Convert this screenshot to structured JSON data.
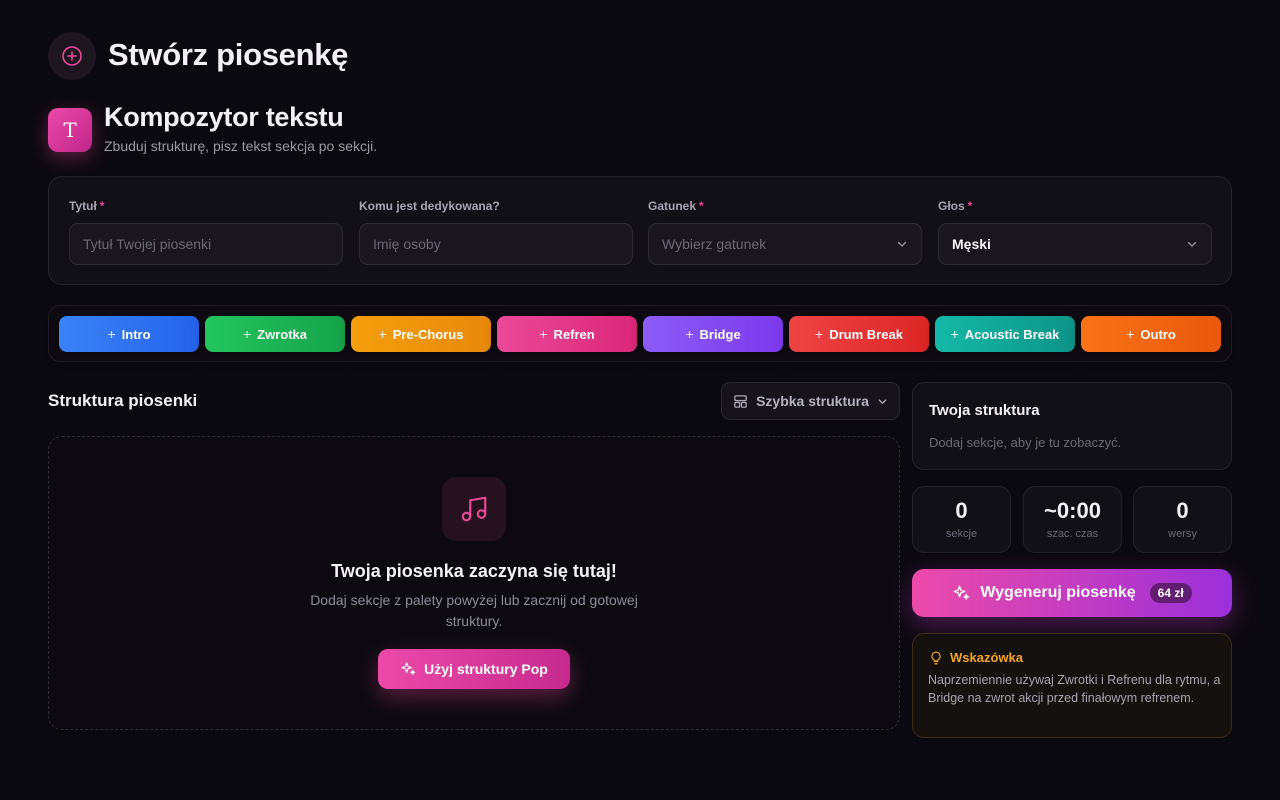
{
  "header": {
    "title": "Stwórz piosenkę",
    "icon": "plus-circle-icon"
  },
  "composer": {
    "icon_letter": "T",
    "title": "Kompozytor tekstu",
    "subtitle": "Zbuduj strukturę, pisz tekst sekcja po sekcji."
  },
  "form": {
    "title_field": {
      "label": "Tytuł",
      "required": "*",
      "placeholder": "Tytuł Twojej piosenki"
    },
    "dedication_field": {
      "label": "Komu jest dedykowana?",
      "placeholder": "Imię osoby"
    },
    "genre_field": {
      "label": "Gatunek",
      "required": "*",
      "placeholder": "Wybierz gatunek"
    },
    "voice_field": {
      "label": "Głos",
      "required": "*",
      "value": "Męski"
    }
  },
  "palette": {
    "items": [
      {
        "label": "Intro",
        "color_from": "#3b82f6",
        "color_to": "#2563eb"
      },
      {
        "label": "Zwrotka",
        "color_from": "#22c55e",
        "color_to": "#16a34a"
      },
      {
        "label": "Pre-Chorus",
        "color_from": "#f59e0b",
        "color_to": "#e8890b"
      },
      {
        "label": "Refren",
        "color_from": "#ec4899",
        "color_to": "#db2777"
      },
      {
        "label": "Bridge",
        "color_from": "#8b5cf6",
        "color_to": "#7c3aed"
      },
      {
        "label": "Drum Break",
        "color_from": "#ef4444",
        "color_to": "#dc2626"
      },
      {
        "label": "Acoustic Break",
        "color_from": "#14b8a6",
        "color_to": "#0d9488"
      },
      {
        "label": "Outro",
        "color_from": "#f97316",
        "color_to": "#ea580c"
      }
    ]
  },
  "structure": {
    "title": "Struktura piosenki",
    "quick_label": "Szybka struktura",
    "empty_title": "Twoja piosenka zaczyna się tutaj!",
    "empty_sub": "Dodaj sekcje z palety powyżej lub zacznij od gotowej struktury.",
    "pop_button": "Użyj struktury Pop"
  },
  "sidebar": {
    "your_structure_title": "Twoja struktura",
    "your_structure_empty": "Dodaj sekcje, aby je tu zobaczyć.",
    "stats": [
      {
        "value": "0",
        "label": "sekcje"
      },
      {
        "value": "~0:00",
        "label": "szac. czas"
      },
      {
        "value": "0",
        "label": "wersy"
      }
    ],
    "generate_label": "Wygeneruj piosenkę",
    "price": "64 zł",
    "tip_title": "Wskazówka",
    "tip_body": "Naprzemiennie używaj Zwrotki i Refrenu dla rytmu, a Bridge na zwrot akcji przed finałowym refrenem."
  },
  "colors": {
    "accent": "#ec4899",
    "accent_purple": "#9b30d9",
    "tip": "#f5a524",
    "background": "#0b0910"
  }
}
